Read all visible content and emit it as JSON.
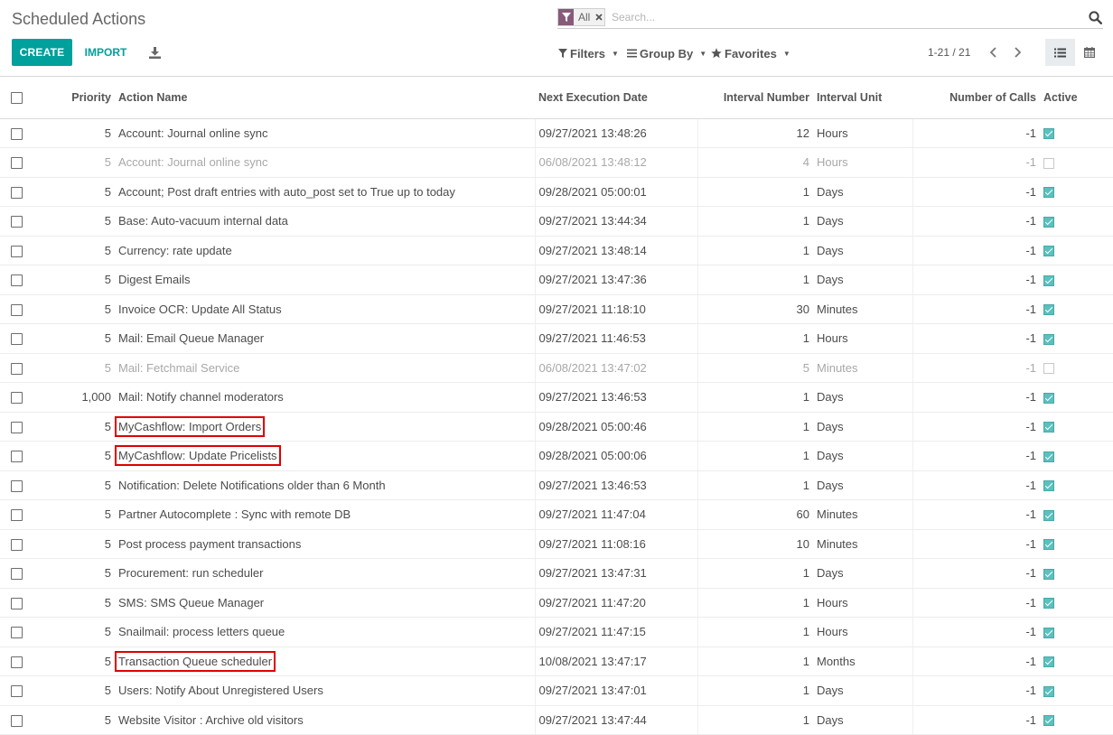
{
  "page": {
    "title": "Scheduled Actions"
  },
  "toolbar": {
    "create_label": "CREATE",
    "import_label": "IMPORT",
    "download_icon": "download-icon"
  },
  "search": {
    "facet_value": "All",
    "placeholder": "Search...",
    "filters_label": "Filters",
    "groupby_label": "Group By",
    "favorites_label": "Favorites"
  },
  "pager": {
    "value": "1-21 / 21"
  },
  "colors": {
    "accent": "#00A09D",
    "facet": "#875A7B",
    "highlight": "#e00000"
  },
  "table": {
    "columns": [
      "Priority",
      "Action Name",
      "Next Execution Date",
      "Interval Number",
      "Interval Unit",
      "Number of Calls",
      "Active"
    ],
    "rows": [
      {
        "priority": "5",
        "name": "Account: Journal online sync",
        "next_date": "09/27/2021 13:48:26",
        "interval_number": "12",
        "interval_unit": "Hours",
        "calls": "-1",
        "active": true,
        "highlight": false
      },
      {
        "priority": "5",
        "name": "Account: Journal online sync",
        "next_date": "06/08/2021 13:48:12",
        "interval_number": "4",
        "interval_unit": "Hours",
        "calls": "-1",
        "active": false,
        "highlight": false
      },
      {
        "priority": "5",
        "name": "Account; Post draft entries with auto_post set to True up to today",
        "next_date": "09/28/2021 05:00:01",
        "interval_number": "1",
        "interval_unit": "Days",
        "calls": "-1",
        "active": true,
        "highlight": false
      },
      {
        "priority": "5",
        "name": "Base: Auto-vacuum internal data",
        "next_date": "09/27/2021 13:44:34",
        "interval_number": "1",
        "interval_unit": "Days",
        "calls": "-1",
        "active": true,
        "highlight": false
      },
      {
        "priority": "5",
        "name": "Currency: rate update",
        "next_date": "09/27/2021 13:48:14",
        "interval_number": "1",
        "interval_unit": "Days",
        "calls": "-1",
        "active": true,
        "highlight": false
      },
      {
        "priority": "5",
        "name": "Digest Emails",
        "next_date": "09/27/2021 13:47:36",
        "interval_number": "1",
        "interval_unit": "Days",
        "calls": "-1",
        "active": true,
        "highlight": false
      },
      {
        "priority": "5",
        "name": "Invoice OCR: Update All Status",
        "next_date": "09/27/2021 11:18:10",
        "interval_number": "30",
        "interval_unit": "Minutes",
        "calls": "-1",
        "active": true,
        "highlight": false
      },
      {
        "priority": "5",
        "name": "Mail: Email Queue Manager",
        "next_date": "09/27/2021 11:46:53",
        "interval_number": "1",
        "interval_unit": "Hours",
        "calls": "-1",
        "active": true,
        "highlight": false
      },
      {
        "priority": "5",
        "name": "Mail: Fetchmail Service",
        "next_date": "06/08/2021 13:47:02",
        "interval_number": "5",
        "interval_unit": "Minutes",
        "calls": "-1",
        "active": false,
        "highlight": false
      },
      {
        "priority": "1,000",
        "name": "Mail: Notify channel moderators",
        "next_date": "09/27/2021 13:46:53",
        "interval_number": "1",
        "interval_unit": "Days",
        "calls": "-1",
        "active": true,
        "highlight": false
      },
      {
        "priority": "5",
        "name": "MyCashflow: Import Orders",
        "next_date": "09/28/2021 05:00:46",
        "interval_number": "1",
        "interval_unit": "Days",
        "calls": "-1",
        "active": true,
        "highlight": true
      },
      {
        "priority": "5",
        "name": "MyCashflow: Update Pricelists",
        "next_date": "09/28/2021 05:00:06",
        "interval_number": "1",
        "interval_unit": "Days",
        "calls": "-1",
        "active": true,
        "highlight": true
      },
      {
        "priority": "5",
        "name": "Notification: Delete Notifications older than 6 Month",
        "next_date": "09/27/2021 13:46:53",
        "interval_number": "1",
        "interval_unit": "Days",
        "calls": "-1",
        "active": true,
        "highlight": false
      },
      {
        "priority": "5",
        "name": "Partner Autocomplete : Sync with remote DB",
        "next_date": "09/27/2021 11:47:04",
        "interval_number": "60",
        "interval_unit": "Minutes",
        "calls": "-1",
        "active": true,
        "highlight": false
      },
      {
        "priority": "5",
        "name": "Post process payment transactions",
        "next_date": "09/27/2021 11:08:16",
        "interval_number": "10",
        "interval_unit": "Minutes",
        "calls": "-1",
        "active": true,
        "highlight": false
      },
      {
        "priority": "5",
        "name": "Procurement: run scheduler",
        "next_date": "09/27/2021 13:47:31",
        "interval_number": "1",
        "interval_unit": "Days",
        "calls": "-1",
        "active": true,
        "highlight": false
      },
      {
        "priority": "5",
        "name": "SMS: SMS Queue Manager",
        "next_date": "09/27/2021 11:47:20",
        "interval_number": "1",
        "interval_unit": "Hours",
        "calls": "-1",
        "active": true,
        "highlight": false
      },
      {
        "priority": "5",
        "name": "Snailmail: process letters queue",
        "next_date": "09/27/2021 11:47:15",
        "interval_number": "1",
        "interval_unit": "Hours",
        "calls": "-1",
        "active": true,
        "highlight": false
      },
      {
        "priority": "5",
        "name": "Transaction Queue scheduler",
        "next_date": "10/08/2021 13:47:17",
        "interval_number": "1",
        "interval_unit": "Months",
        "calls": "-1",
        "active": true,
        "highlight": true
      },
      {
        "priority": "5",
        "name": "Users: Notify About Unregistered Users",
        "next_date": "09/27/2021 13:47:01",
        "interval_number": "1",
        "interval_unit": "Days",
        "calls": "-1",
        "active": true,
        "highlight": false
      },
      {
        "priority": "5",
        "name": "Website Visitor : Archive old visitors",
        "next_date": "09/27/2021 13:47:44",
        "interval_number": "1",
        "interval_unit": "Days",
        "calls": "-1",
        "active": true,
        "highlight": false
      }
    ]
  }
}
